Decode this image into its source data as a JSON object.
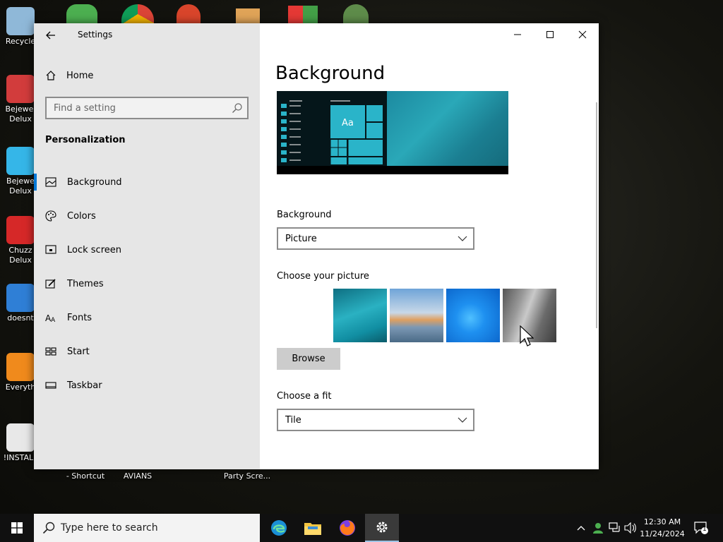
{
  "desktop": {
    "icons": [
      {
        "label": "Recycle",
        "color": "#8fb8d8"
      },
      {
        "label": "Bejewel\nDelux",
        "color": "#d23c3c"
      },
      {
        "label": "Bejewe\nDelux",
        "color": "#35b6e8"
      },
      {
        "label": "Chuzz\nDelux",
        "color": "#d62828"
      },
      {
        "label": "doesnt",
        "color": "#2f7fd6"
      },
      {
        "label": "Everyth",
        "color": "#f08a1c"
      },
      {
        "label": "!INSTALL",
        "color": "#e8e8e8"
      }
    ],
    "bottom_labels": [
      "- Shortcut",
      "AVIANS",
      "Party Scre..."
    ]
  },
  "window": {
    "title": "Settings",
    "minimize_glyph": "—",
    "maximize_glyph": "☐",
    "close_glyph": "✕"
  },
  "sidebar": {
    "home_label": "Home",
    "search_placeholder": "Find a setting",
    "section_title": "Personalization",
    "items": [
      {
        "label": "Background",
        "icon": "image-icon",
        "active": true
      },
      {
        "label": "Colors",
        "icon": "palette-icon",
        "active": false
      },
      {
        "label": "Lock screen",
        "icon": "lock-screen-icon",
        "active": false
      },
      {
        "label": "Themes",
        "icon": "themes-icon",
        "active": false
      },
      {
        "label": "Fonts",
        "icon": "fonts-icon",
        "active": false
      },
      {
        "label": "Start",
        "icon": "start-icon",
        "active": false
      },
      {
        "label": "Taskbar",
        "icon": "taskbar-icon",
        "active": false
      }
    ]
  },
  "content": {
    "page_title": "Background",
    "preview_tile_text": "Aa",
    "background_label": "Background",
    "background_value": "Picture",
    "choose_picture_label": "Choose your picture",
    "browse_label": "Browse",
    "fit_label": "Choose a fit",
    "fit_value": "Tile",
    "accent_color": "#2ab4c9"
  },
  "taskbar": {
    "search_text": "Type here to search",
    "apps": [
      "edge-icon",
      "file-explorer-icon",
      "firefox-icon",
      "settings-icon"
    ],
    "clock_time": "12:30 AM",
    "clock_date": "11/24/2024",
    "notification_count": "1"
  }
}
